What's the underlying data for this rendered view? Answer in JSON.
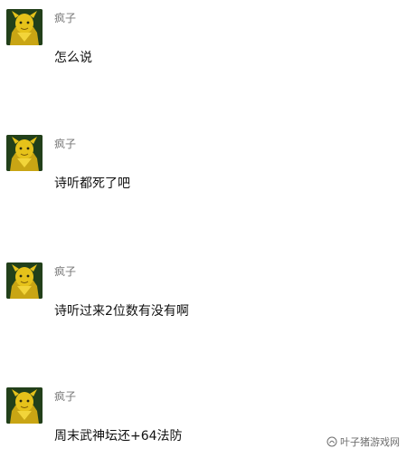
{
  "messages": [
    {
      "sender": "疯子",
      "text": "怎么说",
      "avatar_icon": "yellow-character-avatar-icon"
    },
    {
      "sender": "疯子",
      "text": "诗听都死了吧",
      "avatar_icon": "yellow-character-avatar-icon"
    },
    {
      "sender": "疯子",
      "text": "诗听过来2位数有没有啊",
      "avatar_icon": "yellow-character-avatar-icon"
    },
    {
      "sender": "疯子",
      "text": "周末武神坛还+64法防",
      "avatar_icon": "yellow-character-avatar-icon"
    }
  ],
  "watermark": {
    "text": "叶子猪游戏网",
    "icon": "toutiao-logo-icon"
  },
  "colors": {
    "background": "#ffffff",
    "sender": "#777777",
    "message_text": "#111111",
    "avatar_bg": "#1f3a12",
    "avatar_character": "#e6c21a"
  }
}
